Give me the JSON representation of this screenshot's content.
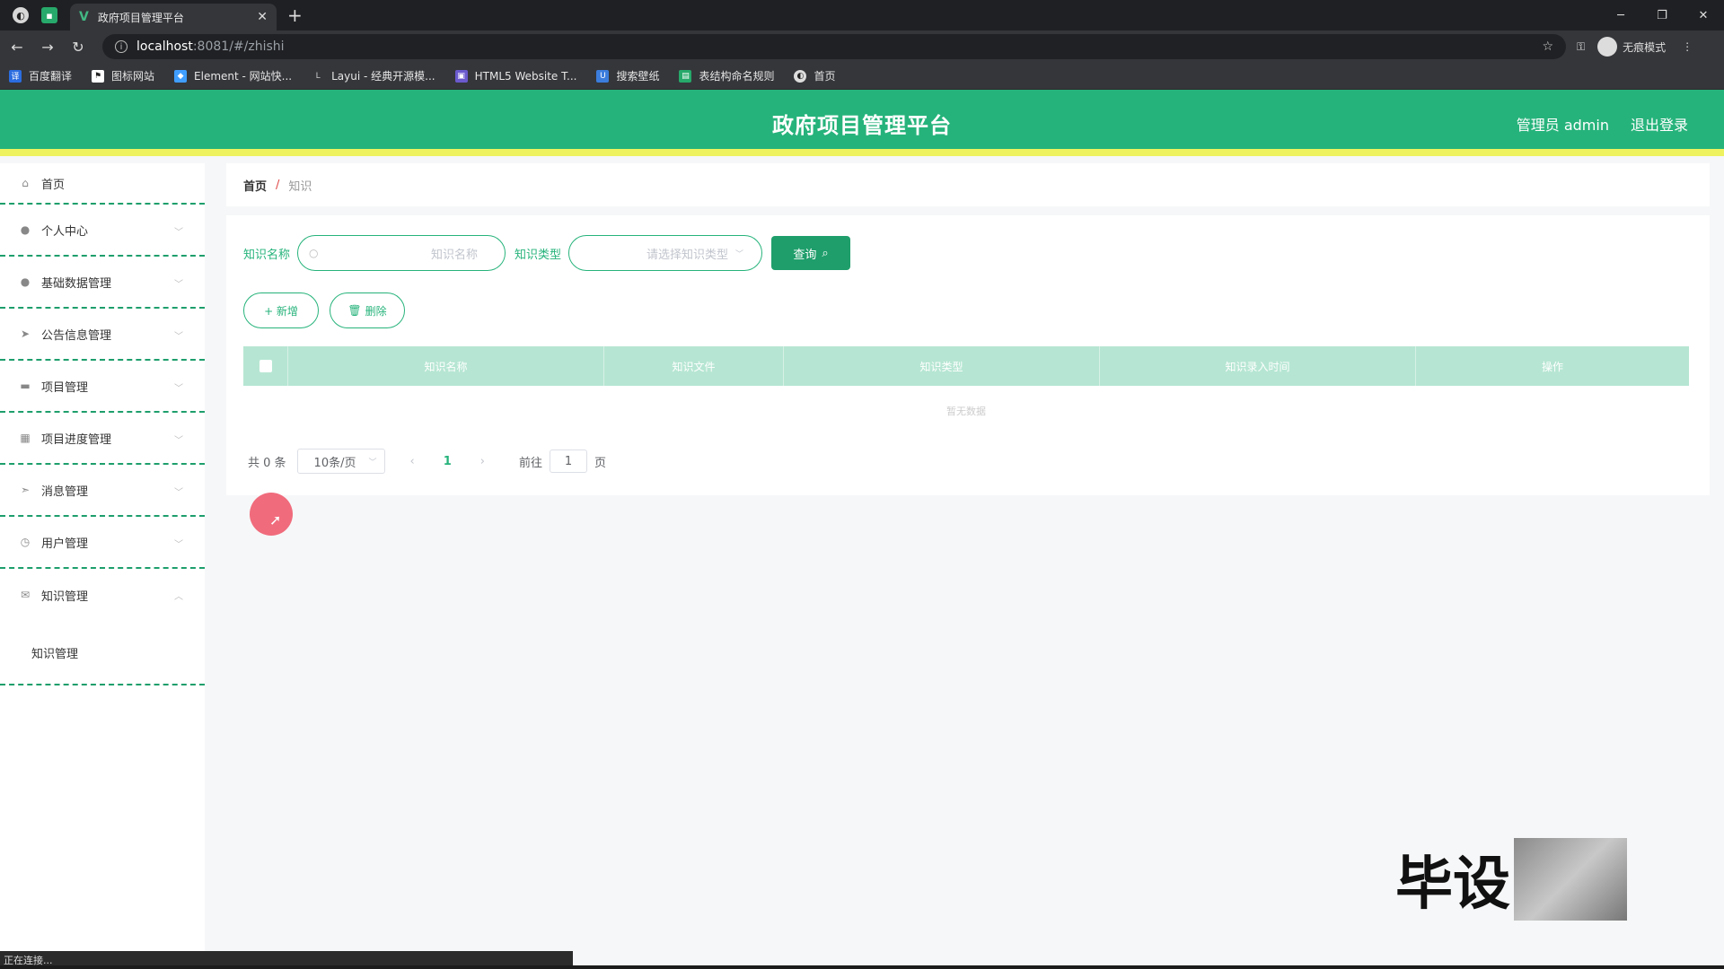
{
  "browser": {
    "tab_title": "政府项目管理平台",
    "url_host": "localhost",
    "url_path": ":8081/#/zhishi",
    "incognito_label": "无痕模式",
    "status_text": "正在连接..."
  },
  "bookmarks": [
    {
      "label": "百度翻译"
    },
    {
      "label": "图标网站"
    },
    {
      "label": "Element - 网站快..."
    },
    {
      "label": "Layui - 经典开源模..."
    },
    {
      "label": "HTML5 Website T..."
    },
    {
      "label": "搜索壁纸"
    },
    {
      "label": "表结构命名规则"
    },
    {
      "label": "首页"
    }
  ],
  "header": {
    "title": "政府项目管理平台",
    "user": "管理员 admin",
    "logout": "退出登录"
  },
  "sidebar": {
    "items": [
      {
        "label": "首页",
        "icon": "home-icon"
      },
      {
        "label": "个人中心",
        "icon": "user-icon"
      },
      {
        "label": "基础数据管理",
        "icon": "user-icon"
      },
      {
        "label": "公告信息管理",
        "icon": "send-icon"
      },
      {
        "label": "项目管理",
        "icon": "chat-icon"
      },
      {
        "label": "项目进度管理",
        "icon": "clipboard-icon"
      },
      {
        "label": "消息管理",
        "icon": "send-icon"
      },
      {
        "label": "用户管理",
        "icon": "clock-icon"
      },
      {
        "label": "知识管理",
        "icon": "mail-icon"
      }
    ],
    "submenu_label": "知识管理"
  },
  "breadcrumb": {
    "home": "首页",
    "separator": "/",
    "current": "知识"
  },
  "search": {
    "name_label": "知识名称",
    "name_placeholder": "知识名称",
    "type_label": "知识类型",
    "type_placeholder": "请选择知识类型",
    "query_button": "查询"
  },
  "actions": {
    "add": "+ 新增",
    "delete": "删除"
  },
  "table": {
    "columns": [
      "知识名称",
      "知识文件",
      "知识类型",
      "知识录入时间",
      "操作"
    ],
    "empty_text": "暂无数据"
  },
  "pagination": {
    "total": "共 0 条",
    "page_size": "10条/页",
    "current_page": "1",
    "goto_label": "前往",
    "goto_value": "1",
    "page_unit": "页"
  },
  "watermark": {
    "text": "毕设"
  },
  "colors": {
    "primary": "#26b37b",
    "header_underline": "#eef25e",
    "table_header": "#b6e6d3"
  }
}
